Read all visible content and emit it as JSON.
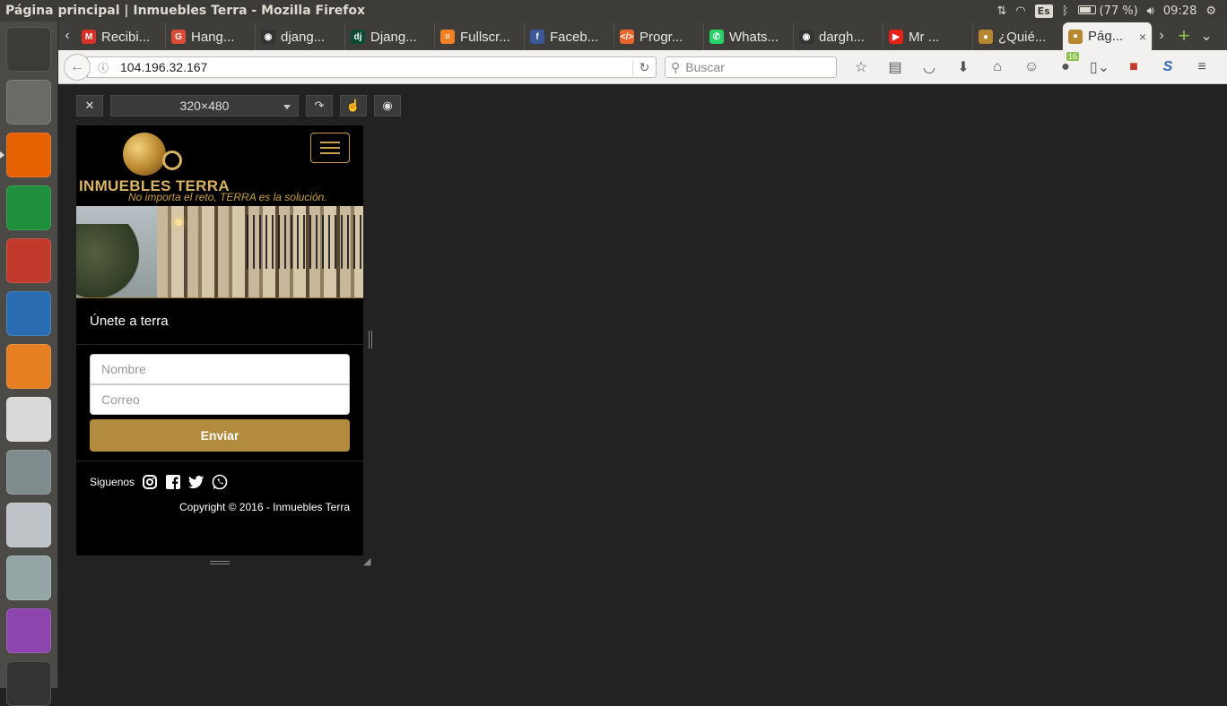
{
  "window": {
    "title": "Página principal | Inmuebles Terra - Mozilla Firefox"
  },
  "indicators": {
    "keyboard": "Es",
    "battery": "(77 %)",
    "time": "09:28"
  },
  "tabs": [
    {
      "label": "Recibi...",
      "icon": "gmail-icon",
      "color": "#d93025",
      "glyph": "M"
    },
    {
      "label": "Hang...",
      "icon": "google-plus-icon",
      "color": "#dd4b39",
      "glyph": "G"
    },
    {
      "label": "djang...",
      "icon": "github-icon",
      "color": "#333333",
      "glyph": "◉"
    },
    {
      "label": "Djang...",
      "icon": "django-icon",
      "color": "#0c4b33",
      "glyph": "dj"
    },
    {
      "label": "Fullscr...",
      "icon": "stackoverflow-icon",
      "color": "#f48024",
      "glyph": "≡"
    },
    {
      "label": "Faceb...",
      "icon": "facebook-icon",
      "color": "#3b5998",
      "glyph": "f"
    },
    {
      "label": "Progr...",
      "icon": "code-icon",
      "color": "#e8652b",
      "glyph": "</>"
    },
    {
      "label": "Whats...",
      "icon": "whatsapp-icon",
      "color": "#25d366",
      "glyph": "✆"
    },
    {
      "label": "dargh...",
      "icon": "github-icon",
      "color": "#333333",
      "glyph": "◉"
    },
    {
      "label": "Mr ...",
      "icon": "youtube-icon",
      "color": "#e62117",
      "glyph": "▶"
    },
    {
      "label": "¿Quié...",
      "icon": "terra-globe-icon",
      "color": "#b8862f",
      "glyph": "●"
    },
    {
      "label": "Pág...",
      "icon": "terra-globe-icon",
      "color": "#b8862f",
      "glyph": "●",
      "active": true
    }
  ],
  "navbar": {
    "url": "104.196.32.167",
    "search_placeholder": "Buscar",
    "badge_count": "16"
  },
  "rdm": {
    "device_size": "320×480"
  },
  "site": {
    "brand": "INMUEBLES TERRA",
    "tagline": "No importa el reto, TERRA es la solución.",
    "join_title": "Únete a terra",
    "name_placeholder": "Nombre",
    "email_placeholder": "Correo",
    "send_label": "Enviar",
    "follow_label": "Siguenos",
    "copyright": "Copyright © 2016 - Inmuebles Terra",
    "accent": "#b38b3f"
  },
  "launcher": [
    {
      "name": "ubuntu-dash-icon",
      "color": "#3c3b37"
    },
    {
      "name": "files-icon",
      "color": "#6b6a66"
    },
    {
      "name": "firefox-icon",
      "color": "#e66000"
    },
    {
      "name": "calc-icon",
      "color": "#1e8f3a"
    },
    {
      "name": "impress-icon",
      "color": "#c0392b"
    },
    {
      "name": "writer-icon",
      "color": "#2a6cb2"
    },
    {
      "name": "software-center-icon",
      "color": "#e67e22"
    },
    {
      "name": "amazon-icon",
      "color": "#d9d9d9"
    },
    {
      "name": "system-settings-icon",
      "color": "#7f8c8d"
    },
    {
      "name": "software-updater-icon",
      "color": "#bdc3c7"
    },
    {
      "name": "disk-icon",
      "color": "#95a5a6"
    },
    {
      "name": "workspace-switcher-icon",
      "color": "#8e44ad"
    },
    {
      "name": "terminal-icon",
      "color": "#333333"
    }
  ]
}
